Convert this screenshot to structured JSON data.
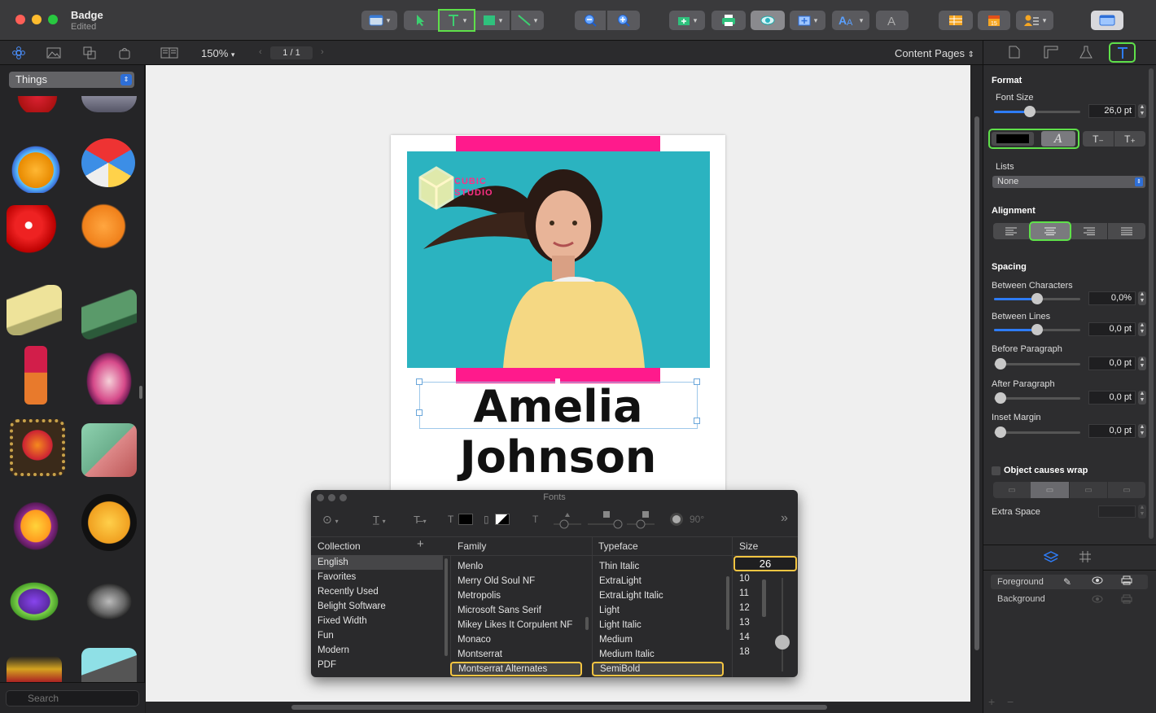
{
  "window": {
    "title": "Badge",
    "subtitle": "Edited"
  },
  "subtoolbar": {
    "zoom": "150%",
    "page_indicator": "1 / 1",
    "content_pages": "Content Pages"
  },
  "library": {
    "category": "Things",
    "search_placeholder": "Search"
  },
  "badge": {
    "logo_line1": "CUBIC",
    "logo_line2": "STUDIO",
    "first_name": "Amelia",
    "last_name": "Johnson"
  },
  "inspector": {
    "format_heading": "Format",
    "font_size_label": "Font Size",
    "font_size_value": "26,0 pt",
    "italic_glyph": "A",
    "lists_label": "Lists",
    "lists_value": "None",
    "alignment_heading": "Alignment",
    "spacing_heading": "Spacing",
    "between_chars_label": "Between Characters",
    "between_chars_value": "0,0%",
    "between_lines_label": "Between Lines",
    "between_lines_value": "0,0 pt",
    "before_para_label": "Before Paragraph",
    "before_para_value": "0,0 pt",
    "after_para_label": "After Paragraph",
    "after_para_value": "0,0 pt",
    "inset_margin_label": "Inset Margin",
    "inset_margin_value": "0,0 pt",
    "wrap_label": "Object causes wrap",
    "extra_space_label": "Extra Space"
  },
  "layers": {
    "items": [
      "Foreground",
      "Background"
    ]
  },
  "fonts_panel": {
    "title": "Fonts",
    "rotation": "90°",
    "headers": {
      "collection": "Collection",
      "family": "Family",
      "typeface": "Typeface",
      "size": "Size"
    },
    "collections": [
      "English",
      "Favorites",
      "Recently Used",
      "Belight Software",
      "Fixed Width",
      "Fun",
      "Modern",
      "PDF"
    ],
    "families": [
      "Menlo",
      "Merry Old Soul NF",
      "Metropolis",
      "Microsoft Sans Serif",
      "Mikey Likes It Corpulent NF",
      "Monaco",
      "Montserrat",
      "Montserrat Alternates"
    ],
    "typefaces": [
      "Thin Italic",
      "ExtraLight",
      "ExtraLight Italic",
      "Light",
      "Light Italic",
      "Medium",
      "Medium Italic",
      "SemiBold"
    ],
    "size_value": "26",
    "sizes": [
      "10",
      "11",
      "12",
      "13",
      "14",
      "18"
    ]
  },
  "colors": {
    "accent_green": "#5fe04a",
    "selection_yellow": "#f5c542",
    "badge_pink": "#ff1a8c",
    "badge_teal": "#2bb3c0",
    "blue": "#2e7cf6"
  }
}
